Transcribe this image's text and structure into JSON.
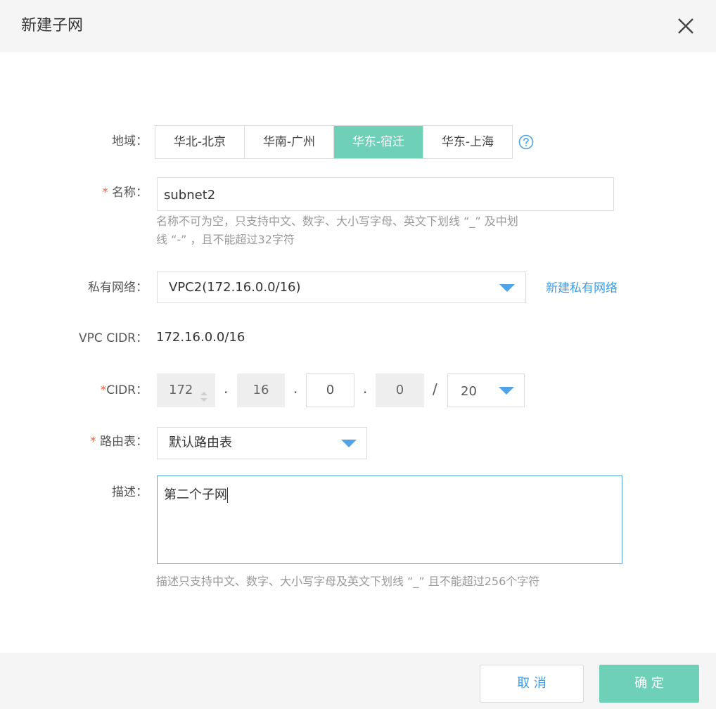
{
  "dialog": {
    "title": "新建子网",
    "close_icon": "close-icon"
  },
  "region": {
    "label": "地域：",
    "options": [
      "华北-北京",
      "华南-广州",
      "华东-宿迁",
      "华东-上海"
    ],
    "selected": "华东-宿迁",
    "help_icon": "question-circle-icon"
  },
  "name": {
    "required_mark": "*",
    "label": " 名称：",
    "value": "subnet2",
    "hint_line1": "名称不可为空，只支持中文、数字、大小写字母、英文下划线 “_” 及中划",
    "hint_line2": "线 “-” ，且不能超过32字符"
  },
  "vpc": {
    "label": "私有网络：",
    "selected": "VPC2(172.16.0.0/16)",
    "new_link": "新建私有网络"
  },
  "vpc_cidr": {
    "label": "VPC CIDR：",
    "value": "172.16.0.0/16"
  },
  "cidr": {
    "required_mark": "*",
    "label": "CIDR：",
    "octet1": "172",
    "octet2": "16",
    "octet3": "0",
    "octet4": "0",
    "dot": ".",
    "slash": "/",
    "mask": "20"
  },
  "route_table": {
    "required_mark": "*",
    "label": " 路由表：",
    "selected": "默认路由表"
  },
  "description": {
    "label": "描述：",
    "value": "第二个子网",
    "hint": "描述只支持中文、数字、大小写字母及英文下划线 “_” 且不能超过256个字符"
  },
  "footer": {
    "cancel_label": "取 消",
    "ok_label": "确 定"
  },
  "colors": {
    "accent_green": "#6fd0b8",
    "link_blue": "#3e9ce6",
    "required_red": "#f0643c"
  }
}
